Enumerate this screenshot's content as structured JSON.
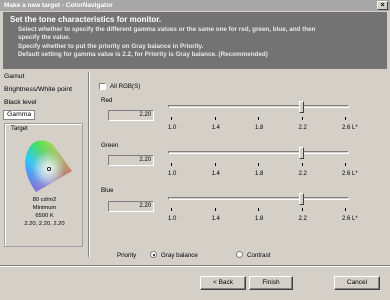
{
  "window": {
    "title": "Make a new target - ColorNavigator",
    "close_glyph": "×"
  },
  "header": {
    "heading": "Set the tone characteristics for monitor.",
    "description_lines": [
      "Select whether to specify the different gamma values or the same one for red, green, blue, and then",
      "specify the value.",
      "Specify whether to put the priority on Gray balance in Priority.",
      "Default setting for gamma value is 2.2, for Priority is Gray balance. (Recommended)"
    ]
  },
  "nav": {
    "items": [
      "Gamut",
      "Brightness/White point",
      "Black level",
      "Gamma"
    ],
    "selected": "Gamma"
  },
  "target": {
    "label": "Target",
    "luminance": "80 cd/m2",
    "black": "Minimum",
    "white_point": "6500 K",
    "gamma": "2.20, 2.20, 2.20"
  },
  "gamma": {
    "all_rgb_label": "All RGB(S)",
    "all_rgb_checked": false,
    "ticks": [
      "1.0",
      "1.4",
      "1.8",
      "2.2",
      "2.6 L*"
    ],
    "channels": [
      {
        "name": "Red",
        "value": "2.20",
        "level": 2.2
      },
      {
        "name": "Green",
        "value": "2.20",
        "level": 2.2
      },
      {
        "name": "Blue",
        "value": "2.20",
        "level": 2.2
      }
    ],
    "range": [
      1.0,
      2.6
    ]
  },
  "priority": {
    "label": "Priority",
    "options": [
      "Gray balance",
      "Contrast"
    ],
    "selected": "Gray balance"
  },
  "buttons": {
    "back": "< Back",
    "finish": "Finish",
    "cancel": "Cancel"
  }
}
